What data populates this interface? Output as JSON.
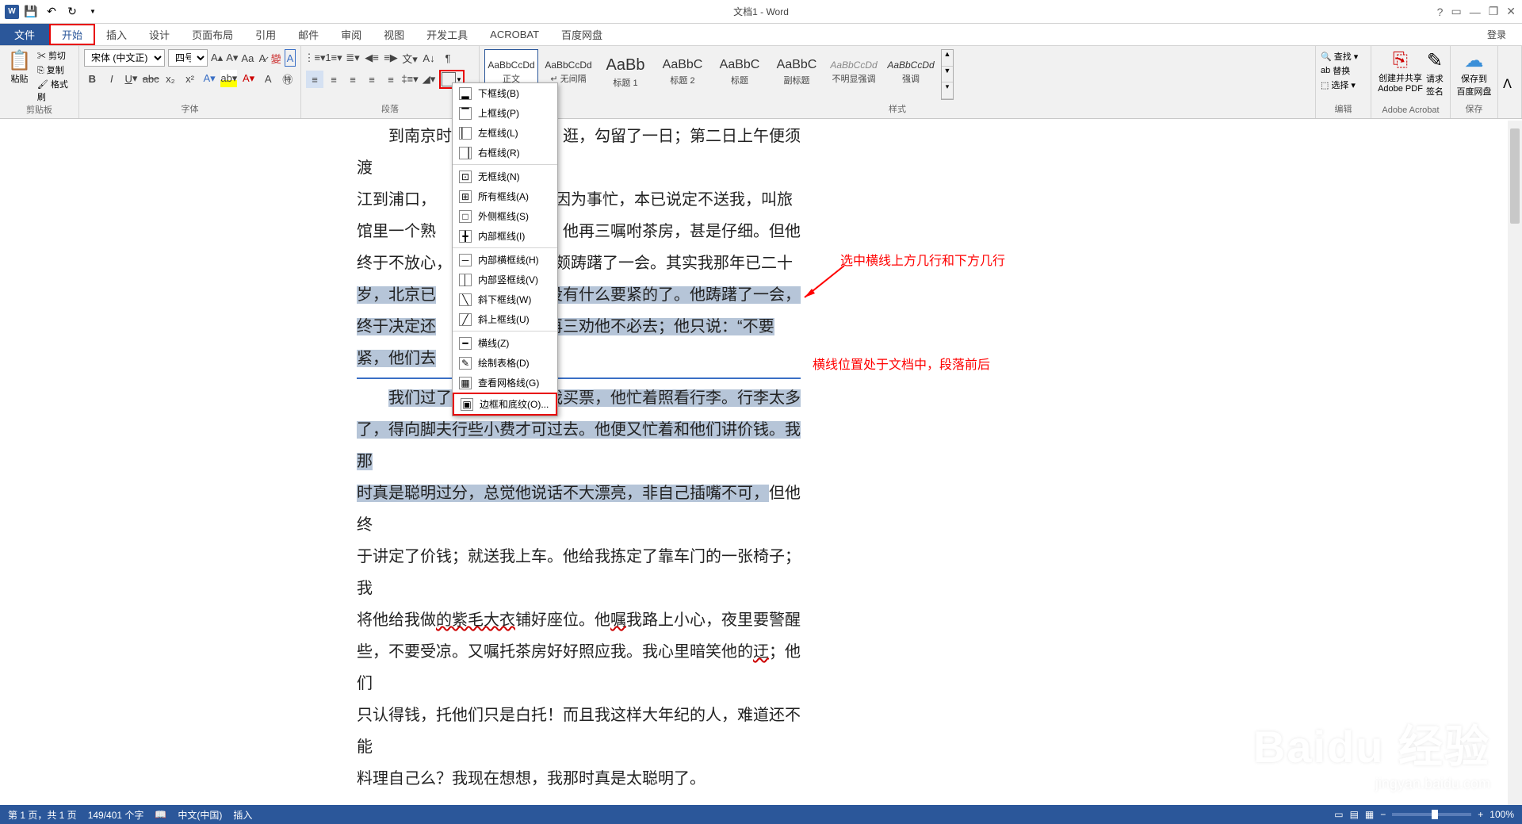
{
  "title": "文档1 - Word",
  "login": "登录",
  "tabs": {
    "file": "文件",
    "home": "开始",
    "insert": "插入",
    "design": "设计",
    "layout": "页面布局",
    "references": "引用",
    "mailings": "邮件",
    "review": "审阅",
    "view": "视图",
    "dev": "开发工具",
    "acrobat": "ACROBAT",
    "baidu": "百度网盘"
  },
  "clipboard": {
    "paste": "粘贴",
    "cut": "剪切",
    "copy": "复制",
    "format": "格式刷",
    "label": "剪贴板"
  },
  "font": {
    "name": "宋体 (中文正)",
    "size": "四号",
    "label": "字体"
  },
  "paragraph": {
    "label": "段落"
  },
  "styles": {
    "label": "样式",
    "items": [
      {
        "preview": "AaBbCcDd",
        "name": "正文",
        "active": true
      },
      {
        "preview": "AaBbCcDd",
        "name": "无间隔"
      },
      {
        "preview": "AaBb",
        "name": "标题 1"
      },
      {
        "preview": "AaBbC",
        "name": "标题 2"
      },
      {
        "preview": "AaBbC",
        "name": "标题"
      },
      {
        "preview": "AaBbC",
        "name": "副标题"
      },
      {
        "preview": "AaBbCcDd",
        "name": "不明显强调"
      },
      {
        "preview": "AaBbCcDd",
        "name": "强调"
      }
    ]
  },
  "edit": {
    "find": "查找",
    "replace": "替换",
    "select": "选择",
    "label": "编辑"
  },
  "acrobat_grp": {
    "create": "创建并共享",
    "pdf": "Adobe PDF",
    "sign": "请求",
    "sign2": "签名",
    "label": "Adobe Acrobat"
  },
  "save_grp": {
    "save": "保存到",
    "baidu": "百度网盘",
    "label": "保存"
  },
  "borders_menu": {
    "bottom": "下框线(B)",
    "top": "上框线(P)",
    "left": "左框线(L)",
    "right": "右框线(R)",
    "none": "无框线(N)",
    "all": "所有框线(A)",
    "outside": "外侧框线(S)",
    "inside": "内部框线(I)",
    "insideH": "内部横框线(H)",
    "insideV": "内部竖框线(V)",
    "diagDown": "斜下框线(W)",
    "diagUp": "斜上框线(U)",
    "hline": "横线(Z)",
    "draw": "绘制表格(D)",
    "grid": "查看网格线(G)",
    "shading": "边框和底纹(O)..."
  },
  "document": {
    "p1_indent": "到南京时",
    "p1_cont": "逛，勾留了一日；第二日上午便须渡",
    "p2": "江到浦口，",
    "p2_cont": "亲因为事忙，本已说定不送我，叫旅",
    "p3": "馆里一个熟",
    "p3_cont": "。他再三嘱咐茶房，甚是仔细。但他",
    "p4": "终于不放心，",
    "p4_cont": "颇踌躇了一会。其实我那年已二十",
    "p5": "岁，北京已",
    "p5_cont": "没有什么要紧的了。他踌躇了一会，",
    "p6": "终于决定还",
    "p6_cont": "再三劝他不必去；他只说：“不要",
    "p7": "紧，他们去",
    "p8_1": "我们过了",
    "p8_2": "我买票，他忙着照看行李。行李太多",
    "p9": "了，得向脚夫行些小费才可过去。他便又忙着和他们讲价钱。我那",
    "p10_1": "时真是聪明过分，总觉他说话不大漂亮，非自己插嘴不可，",
    "p10_2": "但他终",
    "p11": "于讲定了价钱；就送我上车。他给我拣定了靠车门的一张椅子；我",
    "p12_1": "将他给我做",
    "p12_2": "的紫毛大衣",
    "p12_3": "铺好座位。他",
    "p12_4": "嘱",
    "p12_5": "我路上小心，夜里要警醒",
    "p13_1": "些，不要受凉。又嘱托茶房好好照应我。我心里暗笑他的",
    "p13_2": "迂",
    "p13_3": "；他们",
    "p14": "只认得钱，托他们只是白托！而且我这样大年纪的人，难道还不能",
    "p15": "料理自己么？我现在想想，我那时真是太聪明了。"
  },
  "annotations": {
    "a1": "选中横线上方几行和下方几行",
    "a2": "横线位置处于文档中，段落前后"
  },
  "status": {
    "page": "第 1 页，共 1 页",
    "words": "149/401 个字",
    "lang": "中文(中国)",
    "mode": "插入",
    "zoom": "100%"
  },
  "watermark": {
    "logo": "Baidu 经验",
    "sub": "jingyan.baidu.com"
  }
}
